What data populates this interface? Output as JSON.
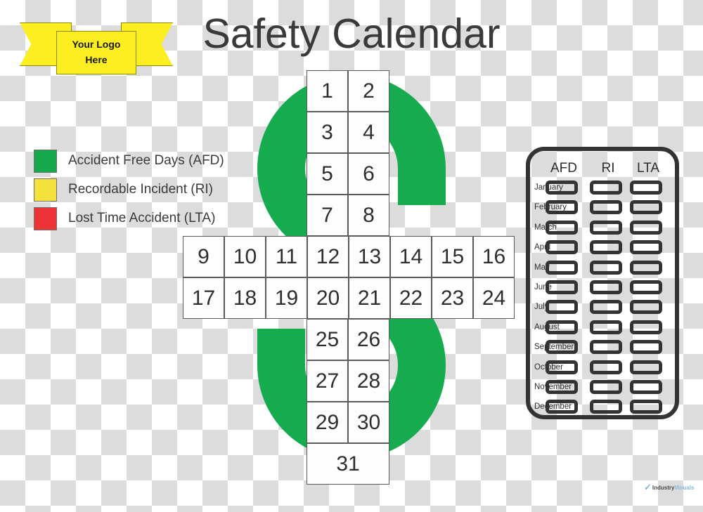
{
  "page_title": "Safety Calendar",
  "logo_ribbon": {
    "line1": "Your Logo",
    "line2": "Here",
    "color": "#FCEE21"
  },
  "legend": {
    "items": [
      {
        "label": "Accident Free Days (AFD)",
        "color": "#15A94C",
        "code": "AFD"
      },
      {
        "label": "Recordable Incident (RI)",
        "color": "#F5E13C",
        "code": "RI"
      },
      {
        "label": "Lost Time Accident (LTA)",
        "color": "#EE3338",
        "code": "LTA"
      }
    ]
  },
  "calendar": {
    "shape": "dollar-sign",
    "shape_color": "#16AB4F",
    "top_block": {
      "columns": 2,
      "days": [
        "1",
        "2",
        "3",
        "4",
        "5",
        "6",
        "7",
        "8"
      ]
    },
    "middle_block": {
      "columns": 8,
      "days": [
        "9",
        "10",
        "11",
        "12",
        "13",
        "14",
        "15",
        "16",
        "17",
        "18",
        "19",
        "20",
        "21",
        "22",
        "23",
        "24"
      ]
    },
    "bottom_block": {
      "columns": 2,
      "days": [
        "25",
        "26",
        "27",
        "28",
        "29",
        "30"
      ]
    },
    "last_day": "31"
  },
  "month_panel": {
    "columns": [
      "AFD",
      "RI",
      "LTA"
    ],
    "months": [
      "January",
      "February",
      "March",
      "April",
      "May",
      "June",
      "July",
      "August",
      "September",
      "October",
      "November",
      "December"
    ]
  },
  "watermark": {
    "check": "✓",
    "text_a": "Industry ",
    "text_b": "Visuals"
  }
}
